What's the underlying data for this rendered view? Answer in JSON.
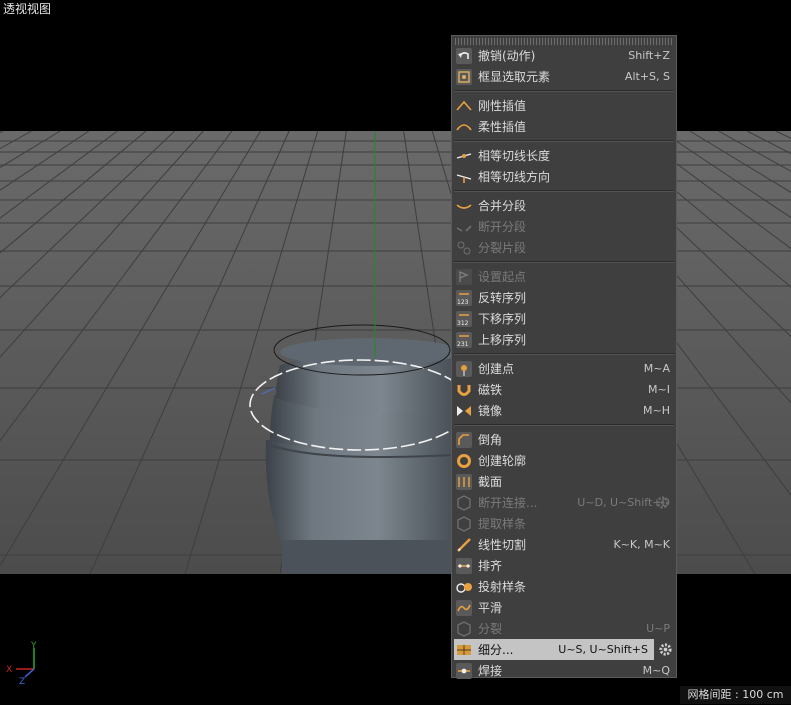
{
  "viewport": {
    "title": "透视视图",
    "grid_info": "网格间距 : 100 cm",
    "axis": {
      "x": "X",
      "y": "Y",
      "z": "Z"
    }
  },
  "colors": {
    "menu_bg": "#3f3f3f",
    "highlight": "#c4c4c4",
    "text": "#dcdcdc",
    "disabled_text": "#7b7b7b",
    "floor": "#5a5a5a",
    "object": "#6b737b",
    "y_axis_line": "#1f8a1f"
  },
  "menu": {
    "groups": [
      [
        {
          "label": "撤销(动作)",
          "shortcut": "Shift+Z",
          "icon": "undo-icon",
          "enabled": true
        },
        {
          "label": "框显选取元素",
          "shortcut": "Alt+S, S",
          "icon": "frame-selection-icon",
          "enabled": true
        }
      ],
      [
        {
          "label": "刚性插值",
          "shortcut": "",
          "icon": "hard-interpolation-icon",
          "enabled": true
        },
        {
          "label": "柔性插值",
          "shortcut": "",
          "icon": "soft-interpolation-icon",
          "enabled": true
        }
      ],
      [
        {
          "label": "相等切线长度",
          "shortcut": "",
          "icon": "equal-tangent-length-icon",
          "enabled": true
        },
        {
          "label": "相等切线方向",
          "shortcut": "",
          "icon": "equal-tangent-direction-icon",
          "enabled": true
        }
      ],
      [
        {
          "label": "合并分段",
          "shortcut": "",
          "icon": "join-segment-icon",
          "enabled": true
        },
        {
          "label": "断开分段",
          "shortcut": "",
          "icon": "break-segment-icon",
          "enabled": false
        },
        {
          "label": "分裂片段",
          "shortcut": "",
          "icon": "explode-segments-icon",
          "enabled": false
        }
      ],
      [
        {
          "label": "设置起点",
          "shortcut": "",
          "icon": "set-first-point-icon",
          "enabled": false
        },
        {
          "label": "反转序列",
          "shortcut": "",
          "icon": "reverse-sequence-icon",
          "enabled": true
        },
        {
          "label": "下移序列",
          "shortcut": "",
          "icon": "move-down-sequence-icon",
          "enabled": true
        },
        {
          "label": "上移序列",
          "shortcut": "",
          "icon": "move-up-sequence-icon",
          "enabled": true
        }
      ],
      [
        {
          "label": "创建点",
          "shortcut": "M~A",
          "icon": "create-point-icon",
          "enabled": true
        },
        {
          "label": "磁铁",
          "shortcut": "M~I",
          "icon": "magnet-icon",
          "enabled": true
        },
        {
          "label": "镜像",
          "shortcut": "M~H",
          "icon": "mirror-icon",
          "enabled": true
        }
      ],
      [
        {
          "label": "倒角",
          "shortcut": "",
          "icon": "chamfer-icon",
          "enabled": true
        },
        {
          "label": "创建轮廓",
          "shortcut": "",
          "icon": "create-outline-icon",
          "enabled": true
        },
        {
          "label": "截面",
          "shortcut": "",
          "icon": "cross-section-icon",
          "enabled": true
        },
        {
          "label": "断开连接...",
          "shortcut": "U~D, U~Shift+D",
          "icon": "disconnect-icon",
          "enabled": false,
          "gear": true
        },
        {
          "label": "提取样条",
          "shortcut": "",
          "icon": "extract-spline-icon",
          "enabled": false
        },
        {
          "label": "线性切割",
          "shortcut": "K~K, M~K",
          "icon": "line-cut-icon",
          "enabled": true
        },
        {
          "label": "排齐",
          "shortcut": "",
          "icon": "line-up-icon",
          "enabled": true
        },
        {
          "label": "投射样条",
          "shortcut": "",
          "icon": "project-spline-icon",
          "enabled": true
        },
        {
          "label": "平滑",
          "shortcut": "",
          "icon": "smooth-icon",
          "enabled": true
        },
        {
          "label": "分裂",
          "shortcut": "U~P",
          "icon": "split-icon",
          "enabled": false
        },
        {
          "label": "细分...",
          "shortcut": "U~S, U~Shift+S",
          "icon": "subdivide-icon",
          "enabled": true,
          "highlighted": true,
          "gear": true
        },
        {
          "label": "焊接",
          "shortcut": "M~Q",
          "icon": "weld-icon",
          "enabled": true
        }
      ]
    ]
  }
}
